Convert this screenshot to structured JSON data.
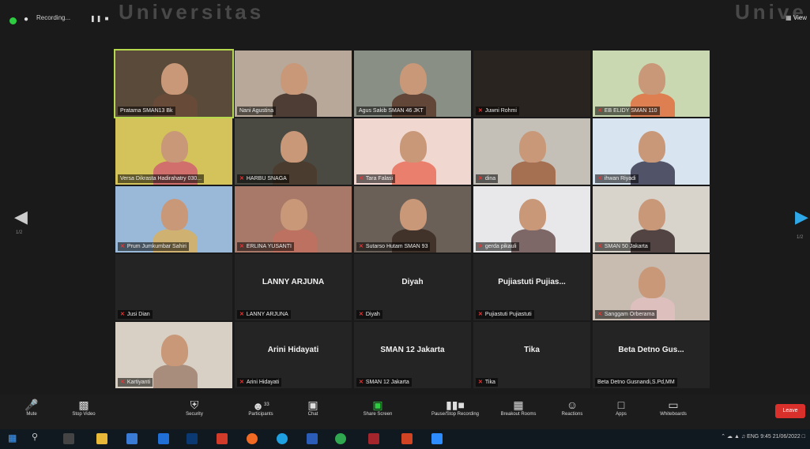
{
  "topbar": {
    "recording_label": "Recording...",
    "view_label": "View"
  },
  "watermark": {
    "left": "Universitas",
    "right": "Unive"
  },
  "nav": {
    "left_page": "1/2",
    "right_page": "1/2"
  },
  "tiles": [
    {
      "name": "Pratama SMAN13 Bk",
      "muted": false,
      "big": ""
    },
    {
      "name": "Nani Agustina",
      "muted": false,
      "big": ""
    },
    {
      "name": "Agus Sakib SMAN 46 JKT",
      "muted": false,
      "big": ""
    },
    {
      "name": "Juwni Rohmi",
      "muted": true,
      "big": ""
    },
    {
      "name": "EB ELIDY SMAN 110",
      "muted": true,
      "big": ""
    },
    {
      "name": "Versa Dikrasta Hadirahatry 030...",
      "muted": false,
      "big": ""
    },
    {
      "name": "HARBU SNAGA",
      "muted": true,
      "big": ""
    },
    {
      "name": "Tara Falasi",
      "muted": true,
      "big": ""
    },
    {
      "name": "dina",
      "muted": true,
      "big": ""
    },
    {
      "name": "ihwan Riyadi",
      "muted": true,
      "big": ""
    },
    {
      "name": "Prum Jumkumbar Sahiri",
      "muted": true,
      "big": ""
    },
    {
      "name": "ERLINA YUSANTI",
      "muted": true,
      "big": ""
    },
    {
      "name": "Sutarso Hutam SMAN 93",
      "muted": true,
      "big": ""
    },
    {
      "name": "gerda pikauli",
      "muted": true,
      "big": ""
    },
    {
      "name": "SMAN 50 Jakarta",
      "muted": true,
      "big": ""
    },
    {
      "name": "Jusi Dian",
      "muted": true,
      "big": ""
    },
    {
      "name": "LANNY ARJUNA",
      "muted": true,
      "big": "LANNY ARJUNA"
    },
    {
      "name": "Diyah",
      "muted": true,
      "big": "Diyah"
    },
    {
      "name": "Pujiastuti Pujiastuti",
      "muted": true,
      "big": "Pujiastuti Pujias..."
    },
    {
      "name": "Sanggam Orberama",
      "muted": true,
      "big": ""
    },
    {
      "name": "Kartiyanti",
      "muted": true,
      "big": ""
    },
    {
      "name": "Arini Hidayati",
      "muted": true,
      "big": "Arini Hidayati"
    },
    {
      "name": "SMAN 12 Jakarta",
      "muted": true,
      "big": "SMAN 12 Jakarta"
    },
    {
      "name": "Tika",
      "muted": true,
      "big": "Tika"
    },
    {
      "name": "Beta Detno Gusnandi,S.Pd,MM",
      "muted": false,
      "big": "Beta Detno Gus..."
    }
  ],
  "toolbar": {
    "mute": "Mute",
    "stop_video": "Stop Video",
    "security": "Security",
    "participants": "Participants",
    "participants_count": "33",
    "chat": "Chat",
    "share_screen": "Share Screen",
    "pause_recording": "Pause/Stop Recording",
    "breakout": "Breakout Rooms",
    "reactions": "Reactions",
    "apps": "Apps",
    "whiteboards": "Whiteboards",
    "leave": "Leave"
  },
  "tray": {
    "lang": "ENG",
    "time": "9:45",
    "date": "21/06/2022"
  },
  "colors": {
    "active_speaker": "#b5d84f",
    "leave": "#d9302c",
    "share": "#2ecc40"
  }
}
